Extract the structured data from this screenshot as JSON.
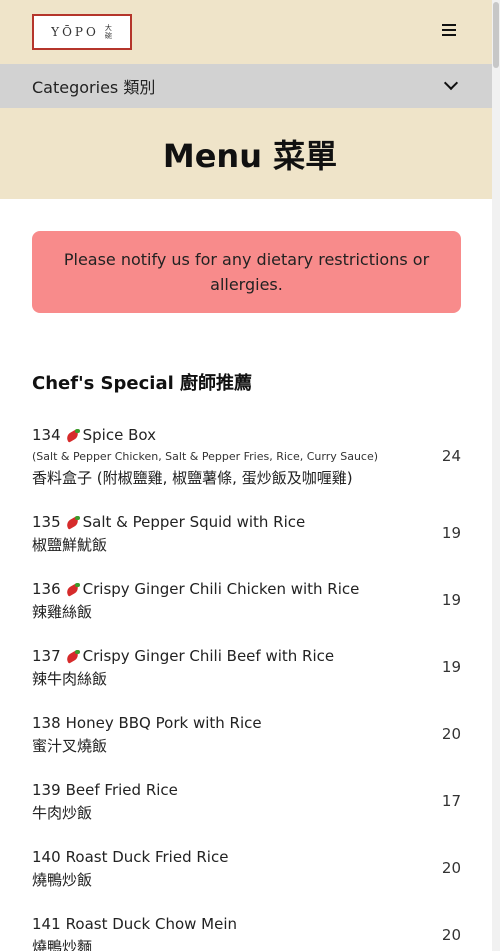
{
  "header": {
    "logo_text": "YŌPO",
    "logo_cn": "大碗"
  },
  "categories": {
    "label": "Categories 類別"
  },
  "hero": {
    "title": "Menu 菜單"
  },
  "notice": {
    "text": "Please notify us for any dietary restrictions or allergies."
  },
  "section": {
    "title": "Chef's Special 廚師推薦"
  },
  "items": [
    {
      "num": "134",
      "spicy": true,
      "name": "Spice Box",
      "desc": "(Salt & Pepper Chicken, Salt & Pepper Fries, Rice, Curry Sauce)",
      "cn": "香料盒子 (附椒鹽雞, 椒鹽薯條, 蛋炒飯及咖喱雞)",
      "price": "24"
    },
    {
      "num": "135",
      "spicy": true,
      "name": "Salt & Pepper Squid with Rice",
      "desc": "",
      "cn": "椒鹽鮮魷飯",
      "price": "19"
    },
    {
      "num": "136",
      "spicy": true,
      "name": "Crispy Ginger Chili Chicken with Rice",
      "desc": "",
      "cn": "辣雞絲飯",
      "price": "19"
    },
    {
      "num": "137",
      "spicy": true,
      "name": "Crispy Ginger Chili Beef with Rice",
      "desc": "",
      "cn": "辣牛肉絲飯",
      "price": "19"
    },
    {
      "num": "138",
      "spicy": false,
      "name": "Honey BBQ Pork with Rice",
      "desc": "",
      "cn": "蜜汁叉燒飯",
      "price": "20"
    },
    {
      "num": "139",
      "spicy": false,
      "name": "Beef Fried Rice",
      "desc": "",
      "cn": "牛肉炒飯",
      "price": "17"
    },
    {
      "num": "140",
      "spicy": false,
      "name": "Roast Duck Fried Rice",
      "desc": "",
      "cn": "燒鴨炒飯",
      "price": "20"
    },
    {
      "num": "141",
      "spicy": false,
      "name": "Roast Duck Chow Mein",
      "desc": "",
      "cn": "燒鴨炒麵",
      "price": "20"
    }
  ]
}
